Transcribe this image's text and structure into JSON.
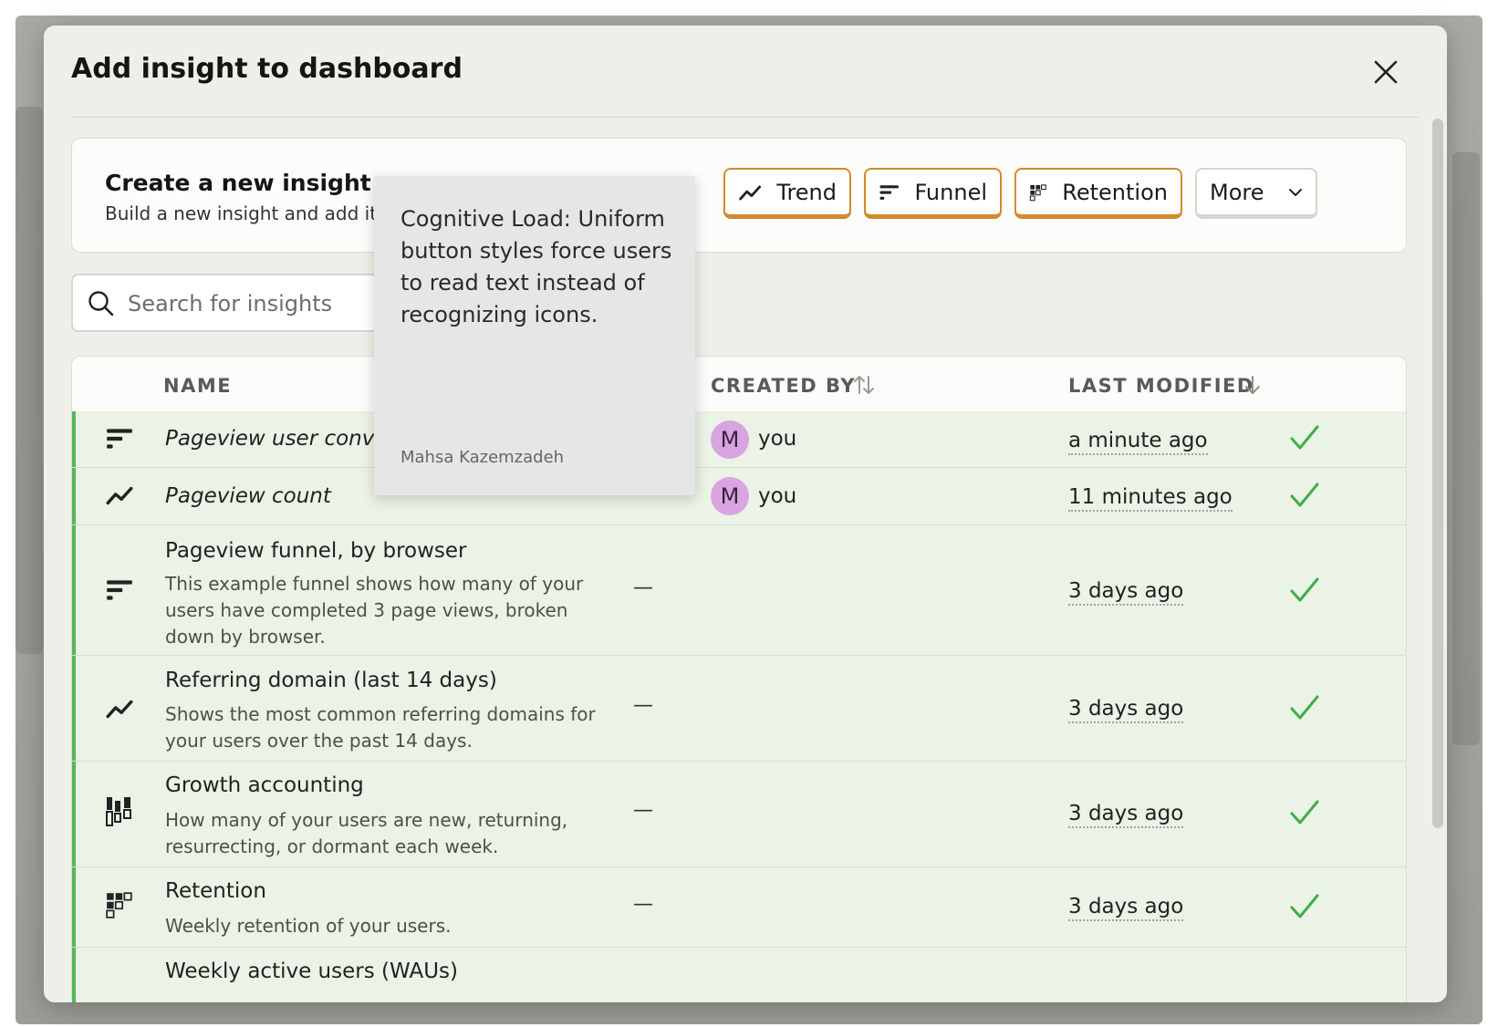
{
  "modal": {
    "title": "Add insight to dashboard"
  },
  "create": {
    "title": "Create a new insight",
    "subtitle": "Build a new insight and add it t",
    "buttons": [
      {
        "label": "Trend",
        "icon": "trend-icon"
      },
      {
        "label": "Funnel",
        "icon": "funnel-icon"
      },
      {
        "label": "Retention",
        "icon": "retention-icon"
      }
    ],
    "more_label": "More"
  },
  "search": {
    "placeholder": "Search for insights",
    "value": ""
  },
  "table": {
    "columns": {
      "name": "NAME",
      "created_by": "CREATED BY",
      "last_modified": "LAST MODIFIED"
    },
    "rows": [
      {
        "icon": "funnel-icon",
        "name": "Pageview user convers",
        "description": "",
        "creator_initial": "M",
        "creator": "you",
        "modified": "a minute ago"
      },
      {
        "icon": "trend-icon",
        "name": "Pageview count",
        "description": "",
        "creator_initial": "M",
        "creator": "you",
        "modified": "11 minutes ago"
      },
      {
        "icon": "funnel-icon",
        "name": "Pageview funnel, by browser",
        "description": "This example funnel shows how many of your users have completed 3 page views, broken down by browser.",
        "creator": "—",
        "modified": "3 days ago"
      },
      {
        "icon": "trend-icon",
        "name": "Referring domain (last 14 days)",
        "description": "Shows the most common referring domains for your users over the past 14 days.",
        "creator": "—",
        "modified": "3 days ago"
      },
      {
        "icon": "lifecycle-icon",
        "name": "Growth accounting",
        "description": "How many of your users are new, returning, resurrecting, or dormant each week.",
        "creator": "—",
        "modified": "3 days ago"
      },
      {
        "icon": "retention-icon",
        "name": "Retention",
        "description": "Weekly retention of your users.",
        "creator": "—",
        "modified": "3 days ago"
      },
      {
        "icon": "trend-icon",
        "name": "Weekly active users (WAUs)",
        "description": "",
        "creator": "",
        "modified": ""
      }
    ]
  },
  "tooltip": {
    "body": "Cognitive Load: Uniform button styles force users to read text instead of recognizing icons.",
    "author": "Mahsa Kazemzadeh"
  },
  "colors": {
    "accent_orange": "#d28b2a",
    "row_bg": "#ebf2e6",
    "row_accent": "#53b85a",
    "check": "#3fae49",
    "avatar": "#d9a4e0"
  }
}
